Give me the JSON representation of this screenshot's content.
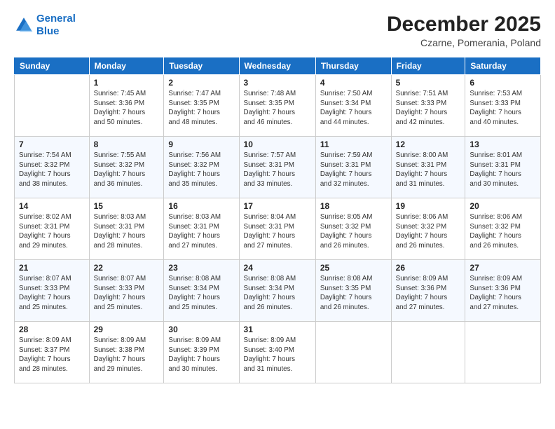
{
  "header": {
    "logo_line1": "General",
    "logo_line2": "Blue",
    "month": "December 2025",
    "location": "Czarne, Pomerania, Poland"
  },
  "weekdays": [
    "Sunday",
    "Monday",
    "Tuesday",
    "Wednesday",
    "Thursday",
    "Friday",
    "Saturday"
  ],
  "weeks": [
    [
      {
        "day": "",
        "info": ""
      },
      {
        "day": "1",
        "info": "Sunrise: 7:45 AM\nSunset: 3:36 PM\nDaylight: 7 hours\nand 50 minutes."
      },
      {
        "day": "2",
        "info": "Sunrise: 7:47 AM\nSunset: 3:35 PM\nDaylight: 7 hours\nand 48 minutes."
      },
      {
        "day": "3",
        "info": "Sunrise: 7:48 AM\nSunset: 3:35 PM\nDaylight: 7 hours\nand 46 minutes."
      },
      {
        "day": "4",
        "info": "Sunrise: 7:50 AM\nSunset: 3:34 PM\nDaylight: 7 hours\nand 44 minutes."
      },
      {
        "day": "5",
        "info": "Sunrise: 7:51 AM\nSunset: 3:33 PM\nDaylight: 7 hours\nand 42 minutes."
      },
      {
        "day": "6",
        "info": "Sunrise: 7:53 AM\nSunset: 3:33 PM\nDaylight: 7 hours\nand 40 minutes."
      }
    ],
    [
      {
        "day": "7",
        "info": "Sunrise: 7:54 AM\nSunset: 3:32 PM\nDaylight: 7 hours\nand 38 minutes."
      },
      {
        "day": "8",
        "info": "Sunrise: 7:55 AM\nSunset: 3:32 PM\nDaylight: 7 hours\nand 36 minutes."
      },
      {
        "day": "9",
        "info": "Sunrise: 7:56 AM\nSunset: 3:32 PM\nDaylight: 7 hours\nand 35 minutes."
      },
      {
        "day": "10",
        "info": "Sunrise: 7:57 AM\nSunset: 3:31 PM\nDaylight: 7 hours\nand 33 minutes."
      },
      {
        "day": "11",
        "info": "Sunrise: 7:59 AM\nSunset: 3:31 PM\nDaylight: 7 hours\nand 32 minutes."
      },
      {
        "day": "12",
        "info": "Sunrise: 8:00 AM\nSunset: 3:31 PM\nDaylight: 7 hours\nand 31 minutes."
      },
      {
        "day": "13",
        "info": "Sunrise: 8:01 AM\nSunset: 3:31 PM\nDaylight: 7 hours\nand 30 minutes."
      }
    ],
    [
      {
        "day": "14",
        "info": "Sunrise: 8:02 AM\nSunset: 3:31 PM\nDaylight: 7 hours\nand 29 minutes."
      },
      {
        "day": "15",
        "info": "Sunrise: 8:03 AM\nSunset: 3:31 PM\nDaylight: 7 hours\nand 28 minutes."
      },
      {
        "day": "16",
        "info": "Sunrise: 8:03 AM\nSunset: 3:31 PM\nDaylight: 7 hours\nand 27 minutes."
      },
      {
        "day": "17",
        "info": "Sunrise: 8:04 AM\nSunset: 3:31 PM\nDaylight: 7 hours\nand 27 minutes."
      },
      {
        "day": "18",
        "info": "Sunrise: 8:05 AM\nSunset: 3:32 PM\nDaylight: 7 hours\nand 26 minutes."
      },
      {
        "day": "19",
        "info": "Sunrise: 8:06 AM\nSunset: 3:32 PM\nDaylight: 7 hours\nand 26 minutes."
      },
      {
        "day": "20",
        "info": "Sunrise: 8:06 AM\nSunset: 3:32 PM\nDaylight: 7 hours\nand 26 minutes."
      }
    ],
    [
      {
        "day": "21",
        "info": "Sunrise: 8:07 AM\nSunset: 3:33 PM\nDaylight: 7 hours\nand 25 minutes."
      },
      {
        "day": "22",
        "info": "Sunrise: 8:07 AM\nSunset: 3:33 PM\nDaylight: 7 hours\nand 25 minutes."
      },
      {
        "day": "23",
        "info": "Sunrise: 8:08 AM\nSunset: 3:34 PM\nDaylight: 7 hours\nand 25 minutes."
      },
      {
        "day": "24",
        "info": "Sunrise: 8:08 AM\nSunset: 3:34 PM\nDaylight: 7 hours\nand 26 minutes."
      },
      {
        "day": "25",
        "info": "Sunrise: 8:08 AM\nSunset: 3:35 PM\nDaylight: 7 hours\nand 26 minutes."
      },
      {
        "day": "26",
        "info": "Sunrise: 8:09 AM\nSunset: 3:36 PM\nDaylight: 7 hours\nand 27 minutes."
      },
      {
        "day": "27",
        "info": "Sunrise: 8:09 AM\nSunset: 3:36 PM\nDaylight: 7 hours\nand 27 minutes."
      }
    ],
    [
      {
        "day": "28",
        "info": "Sunrise: 8:09 AM\nSunset: 3:37 PM\nDaylight: 7 hours\nand 28 minutes."
      },
      {
        "day": "29",
        "info": "Sunrise: 8:09 AM\nSunset: 3:38 PM\nDaylight: 7 hours\nand 29 minutes."
      },
      {
        "day": "30",
        "info": "Sunrise: 8:09 AM\nSunset: 3:39 PM\nDaylight: 7 hours\nand 30 minutes."
      },
      {
        "day": "31",
        "info": "Sunrise: 8:09 AM\nSunset: 3:40 PM\nDaylight: 7 hours\nand 31 minutes."
      },
      {
        "day": "",
        "info": ""
      },
      {
        "day": "",
        "info": ""
      },
      {
        "day": "",
        "info": ""
      }
    ]
  ]
}
